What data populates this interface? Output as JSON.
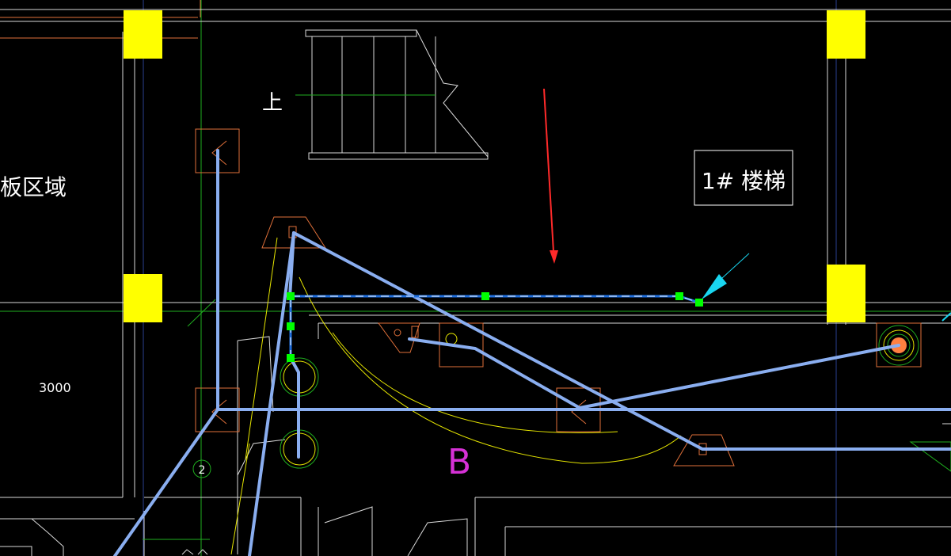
{
  "viewport": {
    "background": "#000000"
  },
  "labels": {
    "area_text": "板区域",
    "up_text": "上",
    "stair_title": "1# 楼梯",
    "dimension": "3000",
    "grid_bubble": "2",
    "axis_letter": "B"
  },
  "colors": {
    "wall": "#d9d9d9",
    "column": "#ffff00",
    "duct": "#8aaef0",
    "selected_line": "#1f6fe0",
    "grip": "#00ff00",
    "symbol": "#e0703a",
    "grid_axis_green": "#1fae1f",
    "grid_axis_blue": "#2a3f8f",
    "annotation_arrow": "#ff2a2a",
    "leader": "#19d6f0",
    "yellow_arc": "#e6e600",
    "axis_letter": "#d631d6",
    "equipment_dot": "#ff8040"
  },
  "icons": {
    "grip_marker": "grip-square-icon",
    "leader_arrow": "cyan-leader-arrow-icon",
    "red_arrow": "red-pointer-arrow-icon",
    "equipment": "equipment-circle-icon"
  }
}
